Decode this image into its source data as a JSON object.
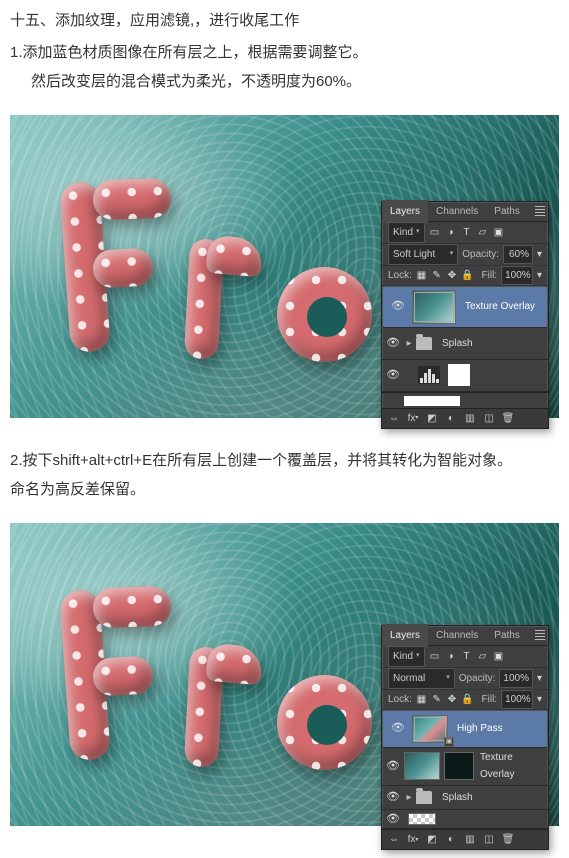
{
  "section_title": "十五、添加纹理，应用滤镜,，进行收尾工作",
  "step1_line1": "1.添加蓝色材质图像在所有层之上，根据需要调整它。",
  "step1_line2": "然后改变层的混合模式为柔光，不透明度为60%。",
  "step2_line1": "2.按下shift+alt+ctrl+E在所有层上创建一个覆盖层，并将其转化为智能对象。",
  "step2_line2": "命名为高反差保留。",
  "panel": {
    "tabs": {
      "layers": "Layers",
      "channels": "Channels",
      "paths": "Paths"
    },
    "kind_label": "Kind",
    "blend1": "Soft Light",
    "blend2": "Normal",
    "opacity_label": "Opacity:",
    "opacity1": "60%",
    "opacity2": "100%",
    "lock_label": "Lock:",
    "fill_label": "Fill:",
    "fill_value": "100%",
    "layer_texture": "Texture Overlay",
    "layer_splash": "Splash",
    "layer_highpass": "High Pass"
  }
}
